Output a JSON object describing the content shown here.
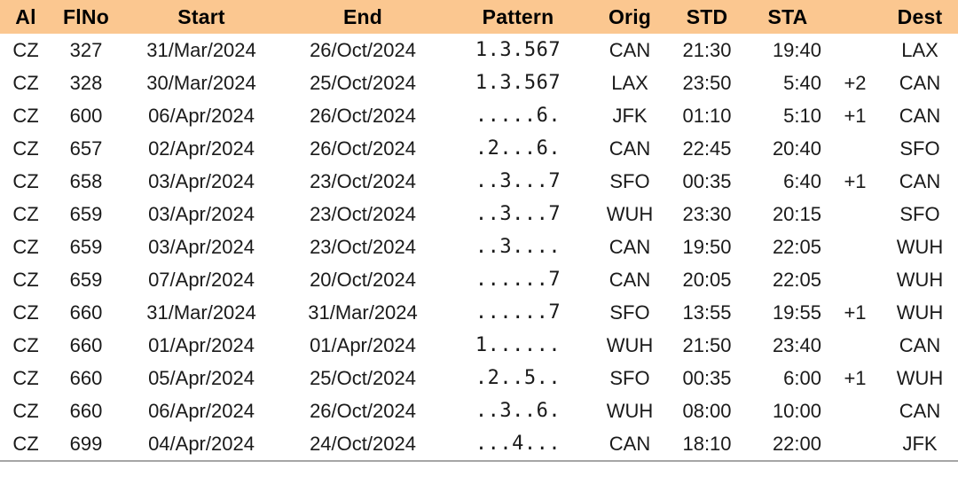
{
  "table": {
    "columns": [
      {
        "key": "ai",
        "label": "Al",
        "css": "col-ai"
      },
      {
        "key": "flno",
        "label": "FlNo",
        "css": "col-flno"
      },
      {
        "key": "start",
        "label": "Start",
        "css": "col-start"
      },
      {
        "key": "end",
        "label": "End",
        "css": "col-end"
      },
      {
        "key": "pattern",
        "label": "Pattern",
        "css": "col-pattern"
      },
      {
        "key": "orig",
        "label": "Orig",
        "css": "col-orig"
      },
      {
        "key": "std",
        "label": "STD",
        "css": "col-std"
      },
      {
        "key": "sta",
        "label": "STA",
        "css": "col-sta"
      },
      {
        "key": "offset",
        "label": "",
        "css": "col-offset"
      },
      {
        "key": "dest",
        "label": "Dest",
        "css": "col-dest"
      }
    ],
    "header_background": "#fbc790",
    "bottom_rule_color": "#a6a6a6",
    "rows": [
      {
        "ai": "CZ",
        "flno": "327",
        "start": "31/Mar/2024",
        "end": "26/Oct/2024",
        "pattern": "1.3.567",
        "orig": "CAN",
        "std": "21:30",
        "sta": "19:40",
        "offset": "",
        "dest": "LAX"
      },
      {
        "ai": "CZ",
        "flno": "328",
        "start": "30/Mar/2024",
        "end": "25/Oct/2024",
        "pattern": "1.3.567",
        "orig": "LAX",
        "std": "23:50",
        "sta": "5:40",
        "offset": "+2",
        "dest": "CAN"
      },
      {
        "ai": "CZ",
        "flno": "600",
        "start": "06/Apr/2024",
        "end": "26/Oct/2024",
        "pattern": ".....6.",
        "orig": "JFK",
        "std": "01:10",
        "sta": "5:10",
        "offset": "+1",
        "dest": "CAN"
      },
      {
        "ai": "CZ",
        "flno": "657",
        "start": "02/Apr/2024",
        "end": "26/Oct/2024",
        "pattern": ".2...6.",
        "orig": "CAN",
        "std": "22:45",
        "sta": "20:40",
        "offset": "",
        "dest": "SFO"
      },
      {
        "ai": "CZ",
        "flno": "658",
        "start": "03/Apr/2024",
        "end": "23/Oct/2024",
        "pattern": "..3...7",
        "orig": "SFO",
        "std": "00:35",
        "sta": "6:40",
        "offset": "+1",
        "dest": "CAN"
      },
      {
        "ai": "CZ",
        "flno": "659",
        "start": "03/Apr/2024",
        "end": "23/Oct/2024",
        "pattern": "..3...7",
        "orig": "WUH",
        "std": "23:30",
        "sta": "20:15",
        "offset": "",
        "dest": "SFO"
      },
      {
        "ai": "CZ",
        "flno": "659",
        "start": "03/Apr/2024",
        "end": "23/Oct/2024",
        "pattern": "..3....",
        "orig": "CAN",
        "std": "19:50",
        "sta": "22:05",
        "offset": "",
        "dest": "WUH"
      },
      {
        "ai": "CZ",
        "flno": "659",
        "start": "07/Apr/2024",
        "end": "20/Oct/2024",
        "pattern": "......7",
        "orig": "CAN",
        "std": "20:05",
        "sta": "22:05",
        "offset": "",
        "dest": "WUH"
      },
      {
        "ai": "CZ",
        "flno": "660",
        "start": "31/Mar/2024",
        "end": "31/Mar/2024",
        "pattern": "......7",
        "orig": "SFO",
        "std": "13:55",
        "sta": "19:55",
        "offset": "+1",
        "dest": "WUH"
      },
      {
        "ai": "CZ",
        "flno": "660",
        "start": "01/Apr/2024",
        "end": "01/Apr/2024",
        "pattern": "1......",
        "orig": "WUH",
        "std": "21:50",
        "sta": "23:40",
        "offset": "",
        "dest": "CAN"
      },
      {
        "ai": "CZ",
        "flno": "660",
        "start": "05/Apr/2024",
        "end": "25/Oct/2024",
        "pattern": ".2..5..",
        "orig": "SFO",
        "std": "00:35",
        "sta": "6:00",
        "offset": "+1",
        "dest": "WUH"
      },
      {
        "ai": "CZ",
        "flno": "660",
        "start": "06/Apr/2024",
        "end": "26/Oct/2024",
        "pattern": "..3..6.",
        "orig": "WUH",
        "std": "08:00",
        "sta": "10:00",
        "offset": "",
        "dest": "CAN"
      },
      {
        "ai": "CZ",
        "flno": "699",
        "start": "04/Apr/2024",
        "end": "24/Oct/2024",
        "pattern": "...4...",
        "orig": "CAN",
        "std": "18:10",
        "sta": "22:00",
        "offset": "",
        "dest": "JFK"
      }
    ]
  }
}
